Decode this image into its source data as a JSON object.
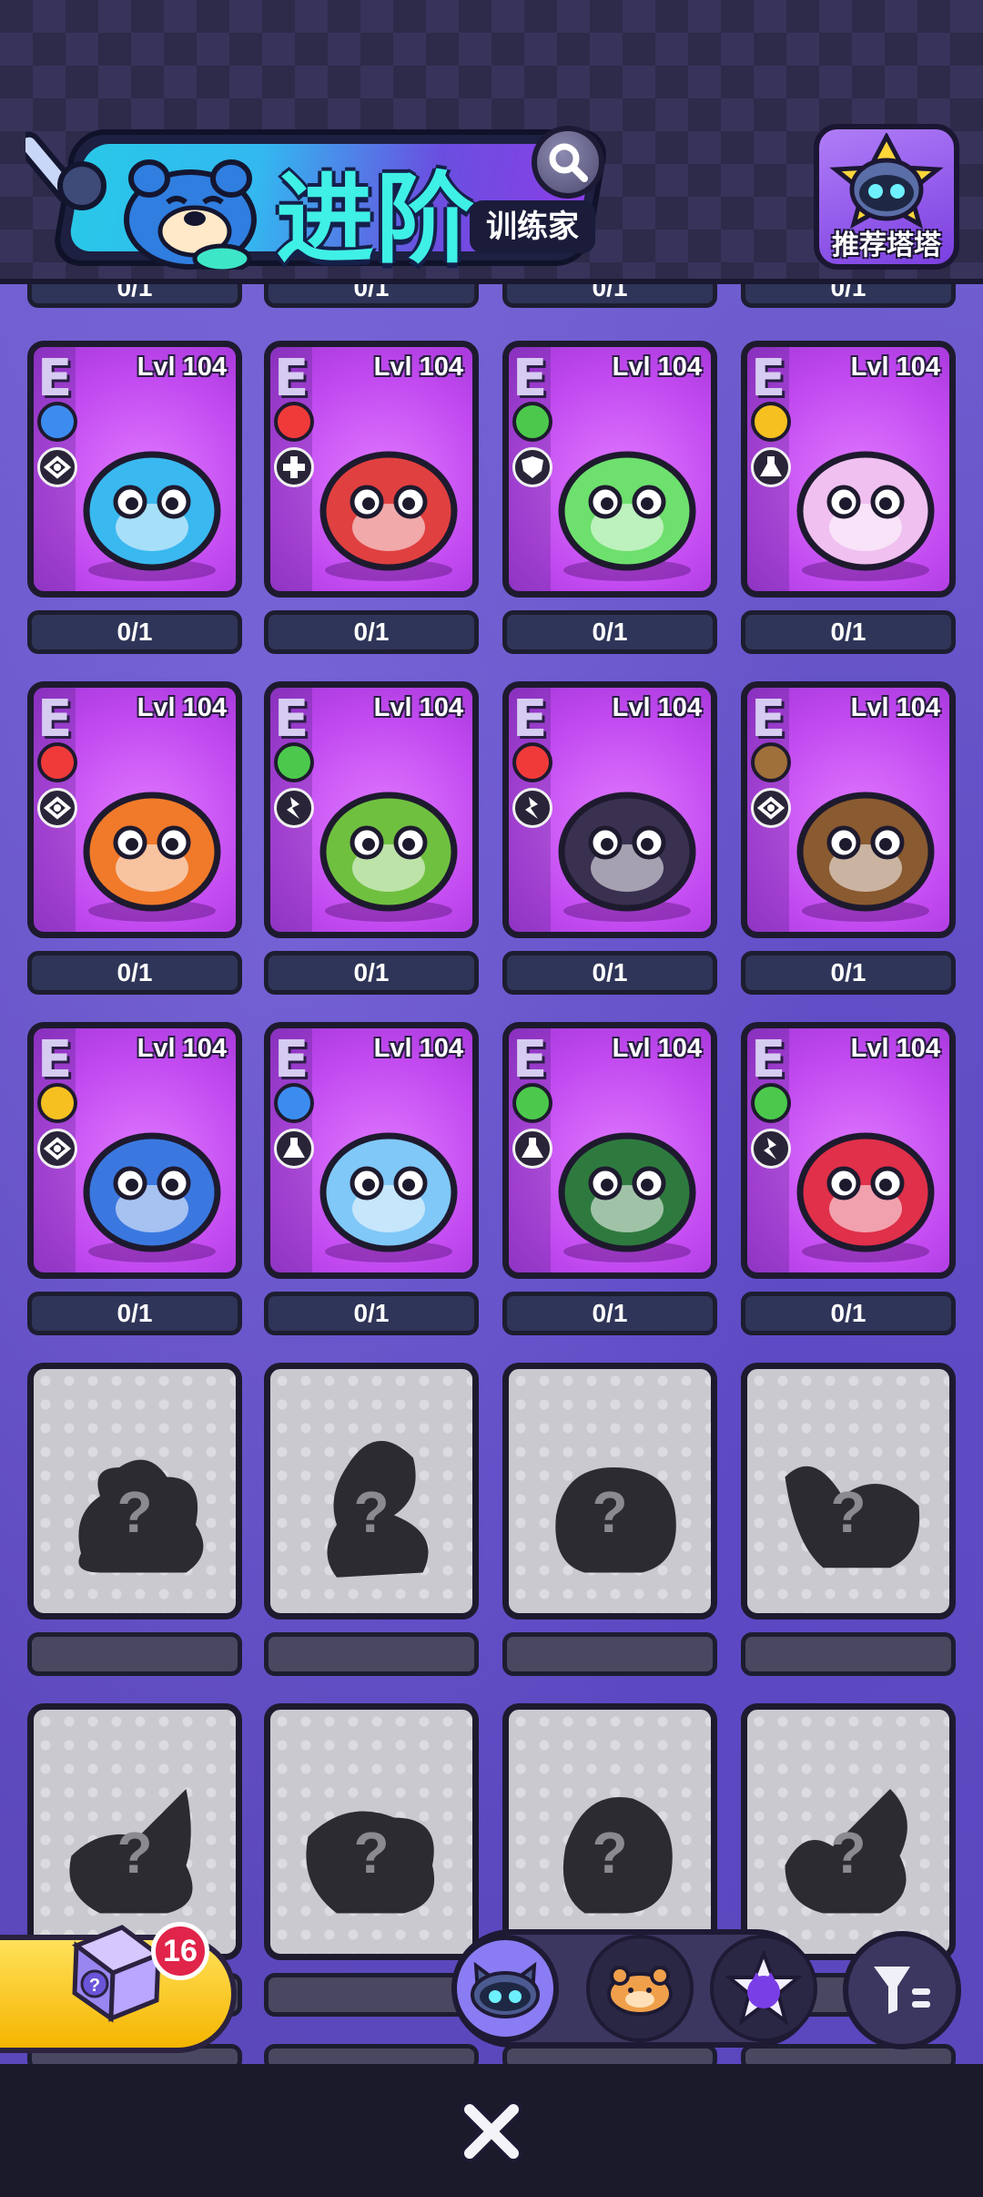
{
  "header": {
    "title": "进阶",
    "subtitle": "训练家",
    "recommend_label": "推荐塔塔"
  },
  "top_counters": [
    "0/1",
    "0/1",
    "0/1",
    "0/1"
  ],
  "cards": [
    {
      "rank": "E",
      "level": "Lvl 104",
      "element": "water",
      "element_color": "#3c8cf0",
      "role": "eye",
      "counter": "0/1",
      "creature": "blue-chameleon",
      "color": "#3ab8f0"
    },
    {
      "rank": "E",
      "level": "Lvl 104",
      "element": "fire",
      "element_color": "#f03a3a",
      "role": "heal",
      "counter": "0/1",
      "creature": "chili-pot",
      "color": "#e04040"
    },
    {
      "rank": "E",
      "level": "Lvl 104",
      "element": "leaf",
      "element_color": "#4cc94c",
      "role": "shield",
      "counter": "0/1",
      "creature": "slime-frog",
      "color": "#6ee06e"
    },
    {
      "rank": "E",
      "level": "Lvl 104",
      "element": "electric",
      "element_color": "#f5c020",
      "role": "potion",
      "counter": "0/1",
      "creature": "star-egg",
      "color": "#f0c0f0"
    },
    {
      "rank": "E",
      "level": "Lvl 104",
      "element": "fire",
      "element_color": "#f03a3a",
      "role": "eye",
      "counter": "0/1",
      "creature": "tiger",
      "color": "#f07a2a"
    },
    {
      "rank": "E",
      "level": "Lvl 104",
      "element": "leaf",
      "element_color": "#4cc94c",
      "role": "speed",
      "counter": "0/1",
      "creature": "cactus",
      "color": "#70c040"
    },
    {
      "rank": "E",
      "level": "Lvl 104",
      "element": "fire",
      "element_color": "#f03a3a",
      "role": "speed",
      "counter": "0/1",
      "creature": "fox-cat",
      "color": "#3a3050"
    },
    {
      "rank": "E",
      "level": "Lvl 104",
      "element": "earth",
      "element_color": "#a0703a",
      "role": "eye",
      "counter": "0/1",
      "creature": "hamster",
      "color": "#8a5a30"
    },
    {
      "rank": "E",
      "level": "Lvl 104",
      "element": "electric",
      "element_color": "#f5c020",
      "role": "eye",
      "counter": "0/1",
      "creature": "dragon-chick",
      "color": "#3a78e0"
    },
    {
      "rank": "E",
      "level": "Lvl 104",
      "element": "water",
      "element_color": "#3c8cf0",
      "role": "potion",
      "counter": "0/1",
      "creature": "axolotl",
      "color": "#80c8f8"
    },
    {
      "rank": "E",
      "level": "Lvl 104",
      "element": "leaf",
      "element_color": "#4cc94c",
      "role": "potion",
      "counter": "0/1",
      "creature": "owl",
      "color": "#2e7a3e"
    },
    {
      "rank": "E",
      "level": "Lvl 104",
      "element": "leaf",
      "element_color": "#4cc94c",
      "role": "speed",
      "counter": "0/1",
      "creature": "berry-bulb",
      "color": "#e0304a"
    }
  ],
  "locked_cards": [
    {
      "mark": "?"
    },
    {
      "mark": "?"
    },
    {
      "mark": "?"
    },
    {
      "mark": "?"
    },
    {
      "mark": "?"
    },
    {
      "mark": "?"
    },
    {
      "mark": "?"
    },
    {
      "mark": "?"
    }
  ],
  "dock": {
    "dice_count": "16",
    "tabs": [
      "cat-robot-tab",
      "hamster-tab",
      "star-cat-tab"
    ],
    "filter_icon": "filter-icon",
    "close_icon": "close-icon"
  },
  "colors": {
    "accent_cyan": "#3ff0e6",
    "card_purple": "#c24af0",
    "counter_bg": "#2f3558",
    "badge_red": "#e1244a",
    "dice_yellow": "#ffd43a"
  }
}
